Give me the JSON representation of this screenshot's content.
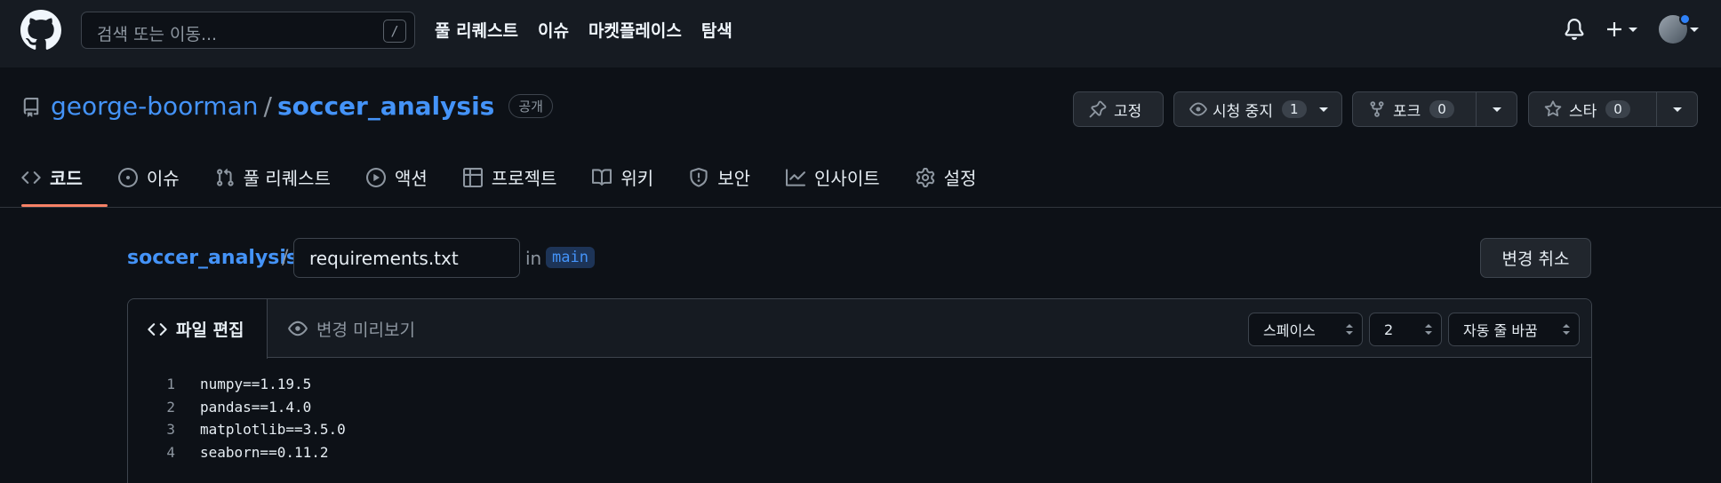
{
  "header": {
    "search_placeholder": "검색 또는 이동...",
    "search_shortcut": "/",
    "nav": [
      "풀 리퀘스트",
      "이슈",
      "마켓플레이스",
      "탐색"
    ]
  },
  "repo": {
    "owner": "george-boorman",
    "separator": "/",
    "name": "soccer_analysis",
    "visibility": "공개",
    "pin_label": "고정",
    "watch_label": "시청 중지",
    "watch_count": "1",
    "fork_label": "포크",
    "fork_count": "0",
    "star_label": "스타",
    "star_count": "0"
  },
  "tabs": [
    {
      "label": "코드",
      "icon": "code-icon",
      "active": true
    },
    {
      "label": "이슈",
      "icon": "issue-icon"
    },
    {
      "label": "풀 리퀘스트",
      "icon": "pull-request-icon"
    },
    {
      "label": "액션",
      "icon": "play-icon"
    },
    {
      "label": "프로젝트",
      "icon": "table-icon"
    },
    {
      "label": "위키",
      "icon": "book-icon"
    },
    {
      "label": "보안",
      "icon": "shield-icon"
    },
    {
      "label": "인사이트",
      "icon": "graph-icon"
    },
    {
      "label": "설정",
      "icon": "gear-icon"
    }
  ],
  "editor": {
    "breadcrumb_repo": "soccer_analysis",
    "breadcrumb_sep": "/",
    "filename": "requirements.txt",
    "in_label": "in",
    "branch": "main",
    "cancel_label": "변경 취소",
    "edit_tab": "파일 편집",
    "preview_tab": "변경 미리보기",
    "indent_mode": "스페이스",
    "indent_size": "2",
    "wrap_mode": "자동 줄 바꿈",
    "lines": [
      {
        "num": "1",
        "text": "numpy==1.19.5"
      },
      {
        "num": "2",
        "text": "pandas==1.4.0"
      },
      {
        "num": "3",
        "text": "matplotlib==3.5.0"
      },
      {
        "num": "4",
        "text": "seaborn==0.11.2"
      }
    ]
  },
  "colors": {
    "accent_link": "#4493f8",
    "tab_underline": "#f78166",
    "background": "#0d1117",
    "header_bg": "#161b22"
  }
}
